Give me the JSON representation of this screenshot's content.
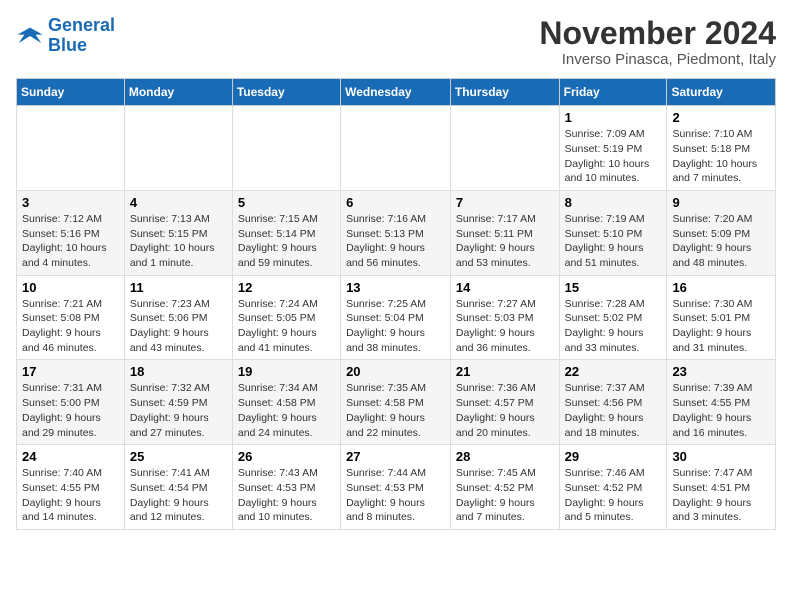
{
  "logo": {
    "line1": "General",
    "line2": "Blue"
  },
  "title": "November 2024",
  "location": "Inverso Pinasca, Piedmont, Italy",
  "weekdays": [
    "Sunday",
    "Monday",
    "Tuesday",
    "Wednesday",
    "Thursday",
    "Friday",
    "Saturday"
  ],
  "weeks": [
    [
      {
        "day": "",
        "info": ""
      },
      {
        "day": "",
        "info": ""
      },
      {
        "day": "",
        "info": ""
      },
      {
        "day": "",
        "info": ""
      },
      {
        "day": "",
        "info": ""
      },
      {
        "day": "1",
        "info": "Sunrise: 7:09 AM\nSunset: 5:19 PM\nDaylight: 10 hours and 10 minutes."
      },
      {
        "day": "2",
        "info": "Sunrise: 7:10 AM\nSunset: 5:18 PM\nDaylight: 10 hours and 7 minutes."
      }
    ],
    [
      {
        "day": "3",
        "info": "Sunrise: 7:12 AM\nSunset: 5:16 PM\nDaylight: 10 hours and 4 minutes."
      },
      {
        "day": "4",
        "info": "Sunrise: 7:13 AM\nSunset: 5:15 PM\nDaylight: 10 hours and 1 minute."
      },
      {
        "day": "5",
        "info": "Sunrise: 7:15 AM\nSunset: 5:14 PM\nDaylight: 9 hours and 59 minutes."
      },
      {
        "day": "6",
        "info": "Sunrise: 7:16 AM\nSunset: 5:13 PM\nDaylight: 9 hours and 56 minutes."
      },
      {
        "day": "7",
        "info": "Sunrise: 7:17 AM\nSunset: 5:11 PM\nDaylight: 9 hours and 53 minutes."
      },
      {
        "day": "8",
        "info": "Sunrise: 7:19 AM\nSunset: 5:10 PM\nDaylight: 9 hours and 51 minutes."
      },
      {
        "day": "9",
        "info": "Sunrise: 7:20 AM\nSunset: 5:09 PM\nDaylight: 9 hours and 48 minutes."
      }
    ],
    [
      {
        "day": "10",
        "info": "Sunrise: 7:21 AM\nSunset: 5:08 PM\nDaylight: 9 hours and 46 minutes."
      },
      {
        "day": "11",
        "info": "Sunrise: 7:23 AM\nSunset: 5:06 PM\nDaylight: 9 hours and 43 minutes."
      },
      {
        "day": "12",
        "info": "Sunrise: 7:24 AM\nSunset: 5:05 PM\nDaylight: 9 hours and 41 minutes."
      },
      {
        "day": "13",
        "info": "Sunrise: 7:25 AM\nSunset: 5:04 PM\nDaylight: 9 hours and 38 minutes."
      },
      {
        "day": "14",
        "info": "Sunrise: 7:27 AM\nSunset: 5:03 PM\nDaylight: 9 hours and 36 minutes."
      },
      {
        "day": "15",
        "info": "Sunrise: 7:28 AM\nSunset: 5:02 PM\nDaylight: 9 hours and 33 minutes."
      },
      {
        "day": "16",
        "info": "Sunrise: 7:30 AM\nSunset: 5:01 PM\nDaylight: 9 hours and 31 minutes."
      }
    ],
    [
      {
        "day": "17",
        "info": "Sunrise: 7:31 AM\nSunset: 5:00 PM\nDaylight: 9 hours and 29 minutes."
      },
      {
        "day": "18",
        "info": "Sunrise: 7:32 AM\nSunset: 4:59 PM\nDaylight: 9 hours and 27 minutes."
      },
      {
        "day": "19",
        "info": "Sunrise: 7:34 AM\nSunset: 4:58 PM\nDaylight: 9 hours and 24 minutes."
      },
      {
        "day": "20",
        "info": "Sunrise: 7:35 AM\nSunset: 4:58 PM\nDaylight: 9 hours and 22 minutes."
      },
      {
        "day": "21",
        "info": "Sunrise: 7:36 AM\nSunset: 4:57 PM\nDaylight: 9 hours and 20 minutes."
      },
      {
        "day": "22",
        "info": "Sunrise: 7:37 AM\nSunset: 4:56 PM\nDaylight: 9 hours and 18 minutes."
      },
      {
        "day": "23",
        "info": "Sunrise: 7:39 AM\nSunset: 4:55 PM\nDaylight: 9 hours and 16 minutes."
      }
    ],
    [
      {
        "day": "24",
        "info": "Sunrise: 7:40 AM\nSunset: 4:55 PM\nDaylight: 9 hours and 14 minutes."
      },
      {
        "day": "25",
        "info": "Sunrise: 7:41 AM\nSunset: 4:54 PM\nDaylight: 9 hours and 12 minutes."
      },
      {
        "day": "26",
        "info": "Sunrise: 7:43 AM\nSunset: 4:53 PM\nDaylight: 9 hours and 10 minutes."
      },
      {
        "day": "27",
        "info": "Sunrise: 7:44 AM\nSunset: 4:53 PM\nDaylight: 9 hours and 8 minutes."
      },
      {
        "day": "28",
        "info": "Sunrise: 7:45 AM\nSunset: 4:52 PM\nDaylight: 9 hours and 7 minutes."
      },
      {
        "day": "29",
        "info": "Sunrise: 7:46 AM\nSunset: 4:52 PM\nDaylight: 9 hours and 5 minutes."
      },
      {
        "day": "30",
        "info": "Sunrise: 7:47 AM\nSunset: 4:51 PM\nDaylight: 9 hours and 3 minutes."
      }
    ]
  ]
}
